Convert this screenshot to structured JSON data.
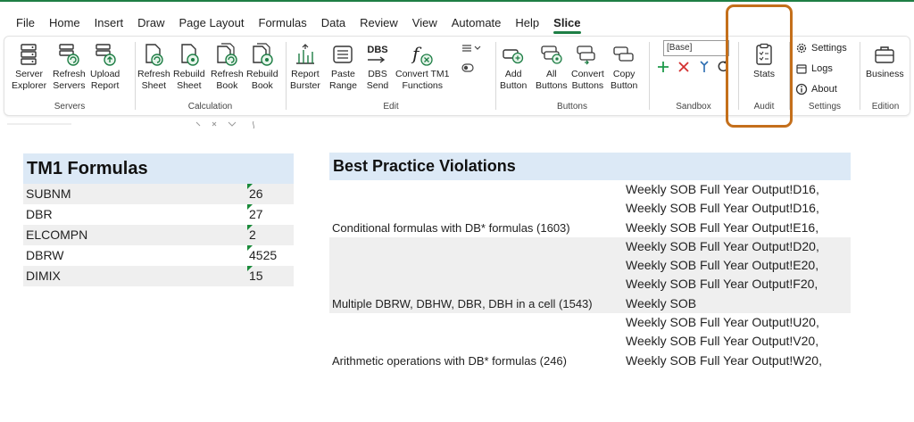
{
  "menu": {
    "tabs": [
      "File",
      "Home",
      "Insert",
      "Draw",
      "Page Layout",
      "Formulas",
      "Data",
      "Review",
      "View",
      "Automate",
      "Help",
      "Slice"
    ],
    "active": "Slice"
  },
  "ribbon": {
    "servers": {
      "label": "Servers",
      "buttons": [
        "Server\nExplorer",
        "Refresh\nServers",
        "Upload\nReport"
      ]
    },
    "calculation": {
      "label": "Calculation",
      "buttons": [
        "Refresh\nSheet",
        "Rebuild\nSheet",
        "Refresh\nBook",
        "Rebuild\nBook"
      ]
    },
    "edit": {
      "label": "Edit",
      "buttons": [
        "Report\nBurster",
        "Paste\nRange",
        "DBS\nSend",
        "Convert TM1\nFunctions"
      ],
      "dbs_icon_text": "DBS"
    },
    "buttons_group": {
      "label": "Buttons",
      "buttons": [
        "Add\nButton",
        "All\nButtons",
        "Convert\nButtons",
        "Copy\nButton"
      ]
    },
    "sandbox": {
      "label": "Sandbox",
      "selected": "[Base]"
    },
    "audit": {
      "label": "Audit",
      "button": "Stats"
    },
    "settings": {
      "label": "Settings",
      "items": [
        "Settings",
        "Logs",
        "About"
      ]
    },
    "edition": {
      "label": "Edition",
      "button": "Business"
    }
  },
  "colors": {
    "accent_green": "#1e7e45",
    "highlight_orange": "#c46f1b",
    "table_header_blue": "#dce9f6",
    "row_gray": "#efefef"
  },
  "tm1_formulas": {
    "title": "TM1 Formulas",
    "rows": [
      {
        "name": "SUBNM",
        "count": "26"
      },
      {
        "name": "DBR",
        "count": "27"
      },
      {
        "name": "ELCOMPN",
        "count": "2"
      },
      {
        "name": "DBRW",
        "count": "4525"
      },
      {
        "name": "DIMIX",
        "count": "15"
      }
    ]
  },
  "best_practice_violations": {
    "title": "Best Practice Violations",
    "groups": [
      {
        "rule": "Conditional formulas with DB* formulas (1603)",
        "locations": [
          "Weekly SOB Full Year Output!D16,",
          "Weekly SOB Full Year Output!D16,",
          "Weekly SOB Full Year Output!E16,"
        ]
      },
      {
        "rule": "Multiple DBRW, DBHW, DBR, DBH in a cell (1543)",
        "locations": [
          "Weekly SOB Full Year Output!D20,",
          "Weekly SOB Full Year Output!E20,",
          "Weekly SOB Full Year Output!F20,",
          "Weekly SOB"
        ]
      },
      {
        "rule": "Arithmetic operations with DB* formulas (246)",
        "locations": [
          "Weekly SOB Full Year Output!U20,",
          "Weekly SOB Full Year Output!V20,",
          "Weekly SOB Full Year Output!W20,"
        ]
      }
    ]
  }
}
